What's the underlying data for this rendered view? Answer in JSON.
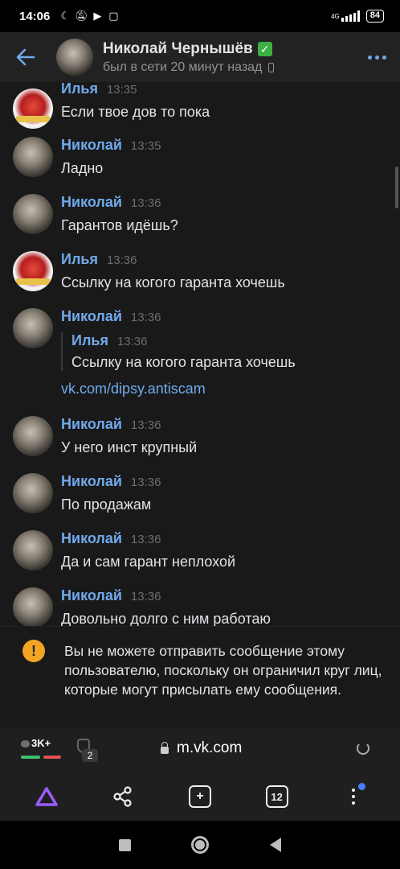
{
  "status_bar": {
    "time": "14:06",
    "network": "4G",
    "battery": "84"
  },
  "header": {
    "contact_name": "Николай Чернышёв",
    "status": "был в сети 20 минут назад"
  },
  "messages": [
    {
      "author": "Илья",
      "time": "13:35",
      "text": "Если твое дов то пока",
      "avatar": "ilya"
    },
    {
      "author": "Николай",
      "time": "13:35",
      "text": "Ладно",
      "avatar": "nikolay"
    },
    {
      "author": "Николай",
      "time": "13:36",
      "text": "Гарантов идёшь?",
      "avatar": "nikolay"
    },
    {
      "author": "Илья",
      "time": "13:36",
      "text": "Ссылку на когого гаранта хочешь",
      "avatar": "ilya"
    },
    {
      "author": "Николай",
      "time": "13:36",
      "avatar": "nikolay",
      "quote": {
        "author": "Илья",
        "time": "13:36",
        "text": "Ссылку на когого гаранта хочешь"
      },
      "link": "vk.com/dipsy.antiscam"
    },
    {
      "author": "Николай",
      "time": "13:36",
      "text": "У него инст крупный",
      "avatar": "nikolay"
    },
    {
      "author": "Николай",
      "time": "13:36",
      "text": "По продажам",
      "avatar": "nikolay"
    },
    {
      "author": "Николай",
      "time": "13:36",
      "text": "Да и сам гарант неплохой",
      "avatar": "nikolay"
    },
    {
      "author": "Николай",
      "time": "13:36",
      "text": "Довольно долго с ним работаю",
      "avatar": "nikolay"
    }
  ],
  "notice": {
    "icon": "!",
    "text": "Вы не можете отправить сообщение этому пользователю, поскольку он ограничил круг лиц, которые могут присылать ему сообщения."
  },
  "browser": {
    "badge": "3K+",
    "tab_badge": "2",
    "url": "m.vk.com",
    "tabs_count": "12"
  },
  "colors": {
    "accent": "#71aaeb",
    "background": "#19191a",
    "warning": "#f4a425"
  }
}
